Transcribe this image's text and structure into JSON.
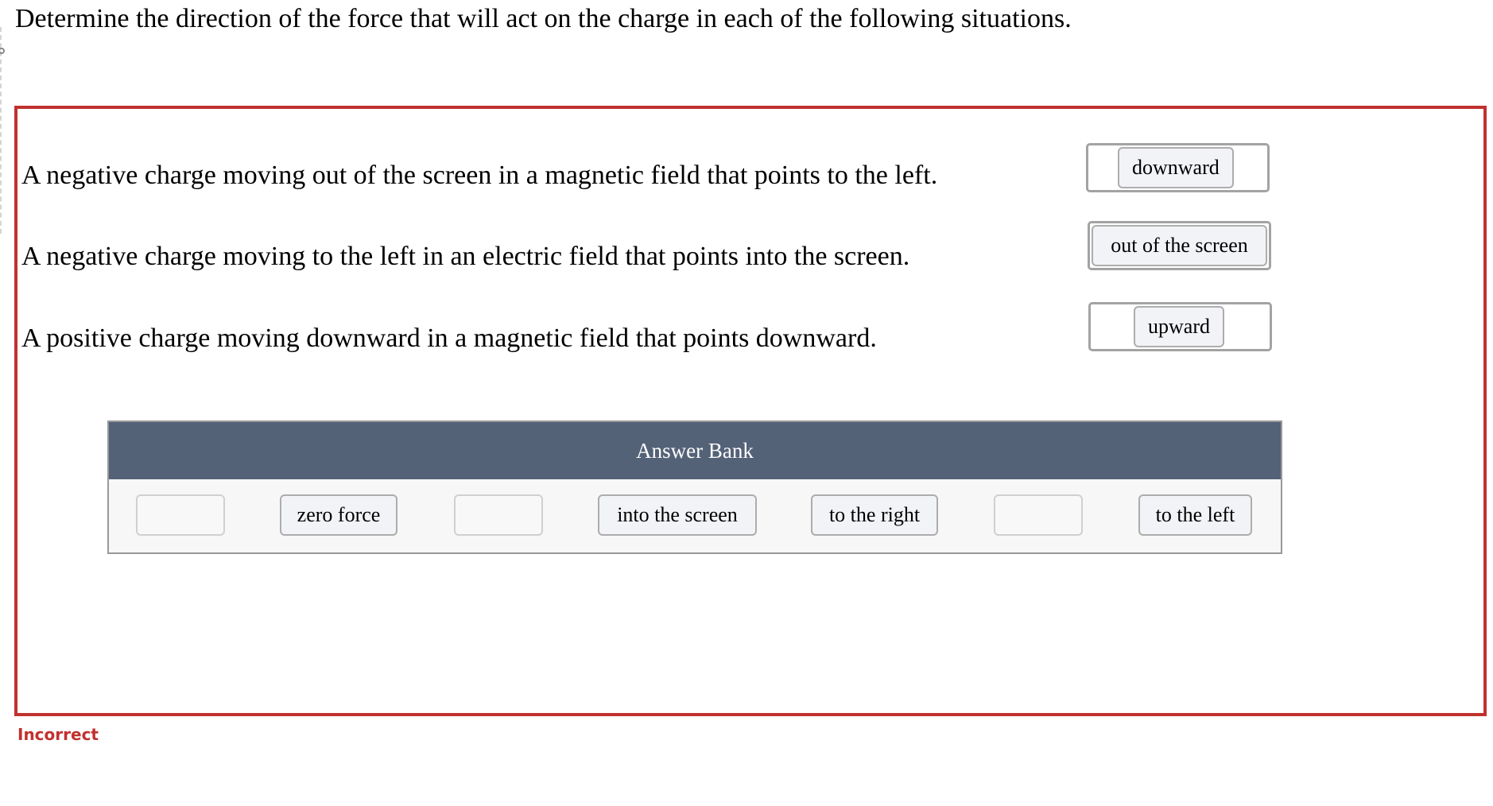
{
  "question": {
    "title": "Determine the direction of the force that will act on the charge in each of the following situations."
  },
  "statements": [
    {
      "text": "A negative charge moving out of the screen in a magnetic field that points to the left.",
      "answer": "downward"
    },
    {
      "text": "A negative charge moving to the left in an electric field that points into the screen.",
      "answer": "out of the screen"
    },
    {
      "text": "A positive charge moving downward in a magnetic field that points downward.",
      "answer": "upward"
    }
  ],
  "answer_bank": {
    "header": "Answer Bank",
    "items": [
      {
        "label": "",
        "empty": true
      },
      {
        "label": "zero force"
      },
      {
        "label": "",
        "empty": true
      },
      {
        "label": "into the screen"
      },
      {
        "label": "to the right"
      },
      {
        "label": "",
        "empty": true
      },
      {
        "label": "to the left"
      }
    ]
  },
  "feedback": {
    "status": "Incorrect",
    "color": "#c1312e"
  },
  "colors": {
    "error_border": "#c1312e",
    "bank_header": "#546278",
    "bank_body": "#f7f7f8",
    "chip_bg": "#f2f3f7"
  }
}
